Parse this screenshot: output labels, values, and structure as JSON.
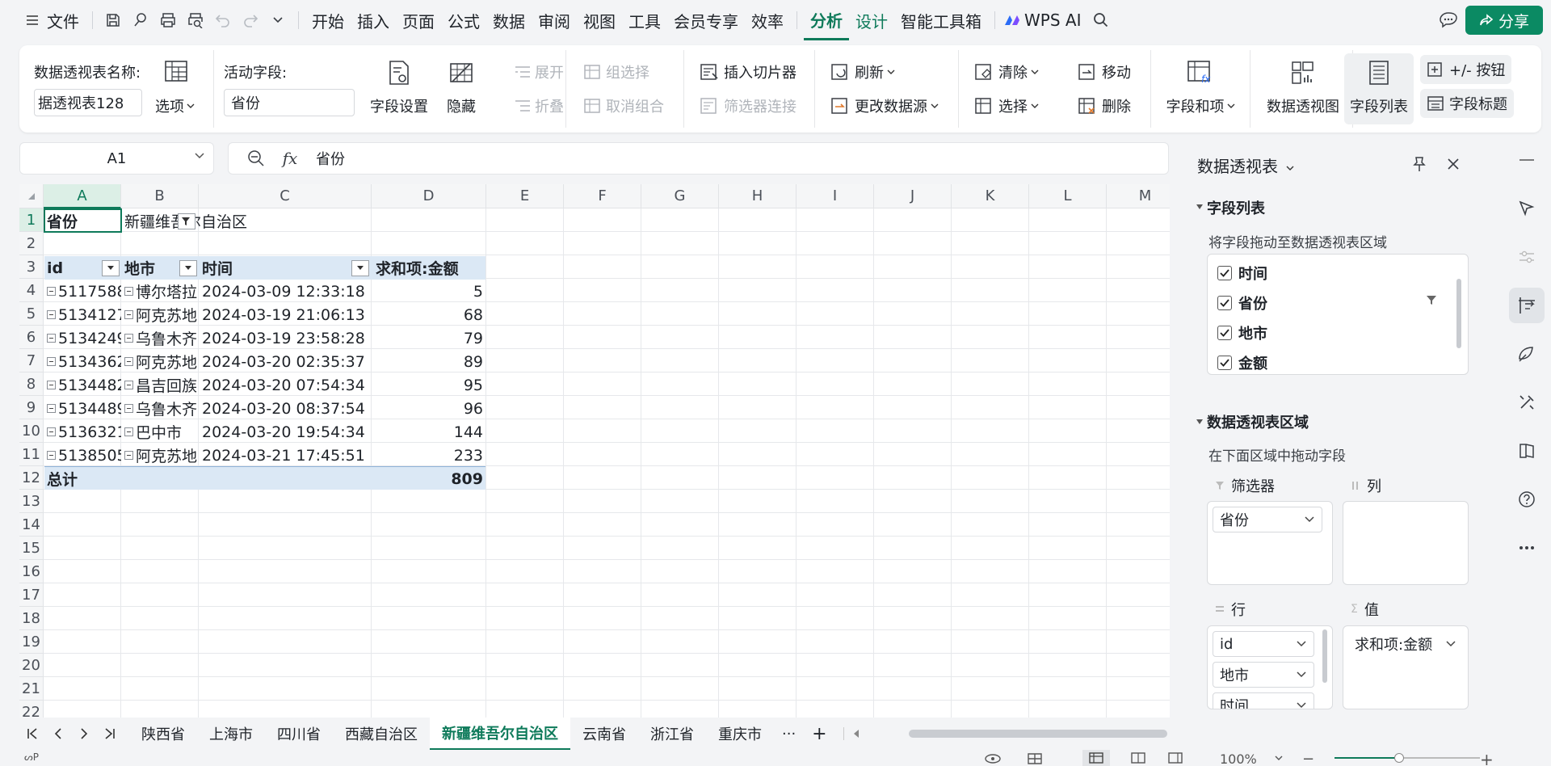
{
  "menubar": {
    "file_label": "文件",
    "items": [
      "开始",
      "插入",
      "页面",
      "公式",
      "数据",
      "审阅",
      "视图",
      "工具",
      "会员专享",
      "效率"
    ],
    "active_tab": "分析",
    "design_tab": "设计",
    "toolbox": "智能工具箱",
    "wps_ai": "WPS AI",
    "share": "分享"
  },
  "ribbon": {
    "pivot_name_label": "数据透视表名称:",
    "pivot_name_value": "据透视表128",
    "options": "选项",
    "active_field_label": "活动字段:",
    "active_field_value": "省份",
    "field_settings": "字段设置",
    "hide": "隐藏",
    "expand": "展开",
    "collapse": "折叠",
    "group_select": "组选择",
    "ungroup": "取消组合",
    "insert_slicer": "插入切片器",
    "filter_connect": "筛选器连接",
    "refresh": "刷新",
    "change_source": "更改数据源",
    "clear": "清除",
    "move": "移动",
    "select": "选择",
    "delete": "删除",
    "fields_items": "字段和项",
    "pivot_chart": "数据透视图",
    "field_list": "字段列表",
    "plus_minus": "+/- 按钮",
    "field_headers": "字段标题"
  },
  "formula": {
    "cell_ref": "A1",
    "content": "省份"
  },
  "grid": {
    "columns": [
      "A",
      "B",
      "C",
      "D",
      "E",
      "F",
      "G",
      "H",
      "I",
      "J",
      "K",
      "L",
      "M"
    ],
    "rows": [
      "1",
      "2",
      "3",
      "4",
      "5",
      "6",
      "7",
      "8",
      "9",
      "10",
      "11",
      "12",
      "13",
      "14",
      "15",
      "16",
      "17",
      "18",
      "19",
      "20",
      "21",
      "22"
    ],
    "filter_label": "省份",
    "filter_value": "新疆维吾尔自治区",
    "headers": [
      "id",
      "地市",
      "时间",
      "求和项:金额"
    ],
    "data": [
      {
        "id": "5117588",
        "city": "博尔塔拉",
        "time": "2024-03-09 12:33:18",
        "amount": "5"
      },
      {
        "id": "5134127",
        "city": "阿克苏地",
        "time": "2024-03-19 21:06:13",
        "amount": "68"
      },
      {
        "id": "5134249",
        "city": "乌鲁木齐",
        "time": "2024-03-19 23:58:28",
        "amount": "79"
      },
      {
        "id": "5134362",
        "city": "阿克苏地",
        "time": "2024-03-20 02:35:37",
        "amount": "89"
      },
      {
        "id": "5134482",
        "city": "昌吉回族",
        "time": "2024-03-20 07:54:34",
        "amount": "95"
      },
      {
        "id": "5134489",
        "city": "乌鲁木齐",
        "time": "2024-03-20 08:37:54",
        "amount": "96"
      },
      {
        "id": "5136321",
        "city": "巴中市",
        "time": "2024-03-20 19:54:34",
        "amount": "144"
      },
      {
        "id": "5138505",
        "city": "阿克苏地",
        "time": "2024-03-21 17:45:51",
        "amount": "233"
      }
    ],
    "total_label": "总计",
    "total_value": "809"
  },
  "sheet_tabs": [
    "陕西省",
    "上海市",
    "四川省",
    "西藏自治区",
    "新疆维吾尔自治区",
    "云南省",
    "浙江省",
    "重庆市"
  ],
  "active_sheet": "新疆维吾尔自治区",
  "more_tabs": "···",
  "add_tab": "+",
  "status": {
    "zoom": "100%"
  },
  "pivot_panel": {
    "title": "数据透视表",
    "field_list_title": "字段列表",
    "field_list_hint": "将字段拖动至数据透视表区域",
    "fields": [
      "时间",
      "省份",
      "地市",
      "金额"
    ],
    "areas_title": "数据透视表区域",
    "areas_hint": "在下面区域中拖动字段",
    "filter_area": "筛选器",
    "column_area": "列",
    "row_area": "行",
    "value_area": "值",
    "filter_fields": [
      "省份"
    ],
    "row_fields": [
      "id",
      "地市",
      "时间"
    ],
    "value_fields": [
      "求和项:金额"
    ]
  },
  "colors": {
    "accent": "#0e7a5a",
    "share_bg": "#0b8a63",
    "header_band": "#dbe8f5"
  }
}
